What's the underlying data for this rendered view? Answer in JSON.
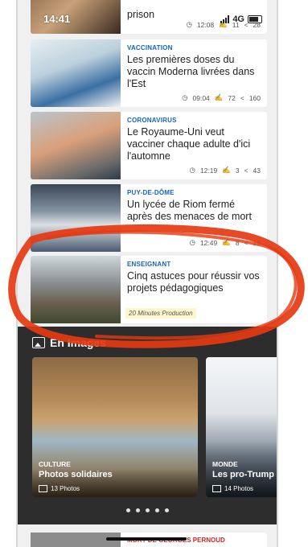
{
  "status": {
    "time": "14:41",
    "network": "4G"
  },
  "articles": [
    {
      "category": "",
      "title": "prison",
      "time": "12:08",
      "comments": "11",
      "shares": "28"
    },
    {
      "category": "VACCINATION",
      "title": "Les premières doses du vaccin Moderna livrées dans l'Est",
      "time": "09:04",
      "comments": "72",
      "shares": "160"
    },
    {
      "category": "CORONAVIRUS",
      "title": "Le Royaume-Uni veut vacciner chaque adulte d'ici l'automne",
      "time": "12:19",
      "comments": "3",
      "shares": "43"
    },
    {
      "category": "PUY-DE-DÔME",
      "title": "Un lycée de Riom fermé après des menaces de mort",
      "time": "12:49",
      "comments": "8",
      "shares": "19"
    },
    {
      "category": "ENSEIGNANT",
      "title": "Cinq astuces pour réussir vos projets pédagogiques",
      "sponsor": "20 Minutes Production"
    }
  ],
  "images_section": {
    "title": "En Images",
    "cards": [
      {
        "category": "CULTURE",
        "title": "Photos solidaires",
        "count": "13 Photos"
      },
      {
        "category": "MONDE",
        "title": "Les pro-Trump à",
        "count": "14 Photos"
      }
    ]
  },
  "bottom_article": {
    "category": "MORT DE GEORGES PERNOUD"
  },
  "colors": {
    "category_blue": "#1565c0",
    "annotation_red": "#e53a12",
    "section_dark": "#2d2d2d"
  }
}
